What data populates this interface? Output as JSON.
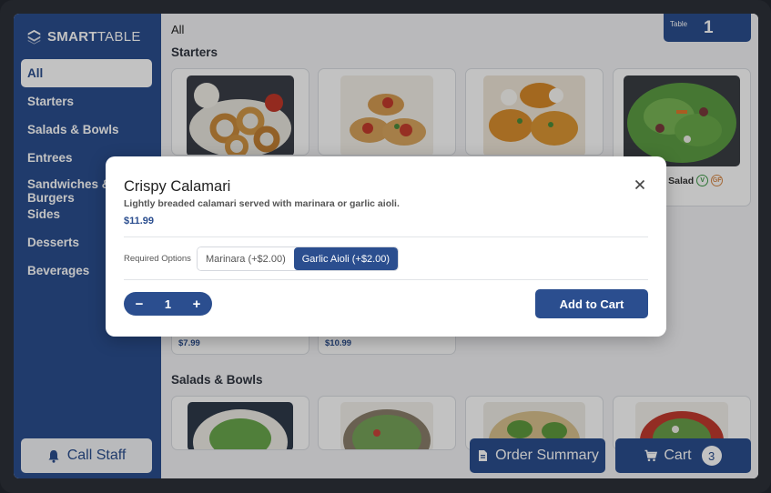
{
  "brand": {
    "name_bold": "SMART",
    "name_light": "TABLE"
  },
  "sidebar": {
    "items": [
      {
        "label": "All"
      },
      {
        "label": "Starters"
      },
      {
        "label": "Salads & Bowls"
      },
      {
        "label": "Entrees"
      },
      {
        "label": "Sandwiches & Burgers"
      },
      {
        "label": "Sides"
      },
      {
        "label": "Desserts"
      },
      {
        "label": "Beverages"
      }
    ],
    "call_staff_label": "Call Staff"
  },
  "header": {
    "breadcrumb": "All",
    "table_label": "Table",
    "table_number": "1"
  },
  "sections": {
    "starters_title": "Starters",
    "salads_title": "Salads & Bowls"
  },
  "cards": {
    "garden_salad_name_partial": "en Salad",
    "diet_v": "V",
    "diet_gf": "GF",
    "price_a": "$7.99",
    "price_b": "$10.99"
  },
  "bottom": {
    "order_summary_label": "Order Summary",
    "cart_label": "Cart",
    "cart_count": "3"
  },
  "modal": {
    "title": "Crispy Calamari",
    "description": "Lightly breaded calamari served with marinara or garlic aioli.",
    "price": "$11.99",
    "required_options_label": "Required Options",
    "options": [
      {
        "label": "Marinara (+$2.00)",
        "selected": false
      },
      {
        "label": "Garlic Aioli (+$2.00)",
        "selected": true
      }
    ],
    "quantity": "1",
    "decrement": "−",
    "increment": "+",
    "add_to_cart_label": "Add to Cart"
  },
  "colors": {
    "primary": "#2b4e8f",
    "background": "#f3f4f6",
    "card": "#ffffff"
  },
  "icons": [
    "logo-icon",
    "bell-icon",
    "document-icon",
    "cart-icon",
    "close-icon"
  ]
}
